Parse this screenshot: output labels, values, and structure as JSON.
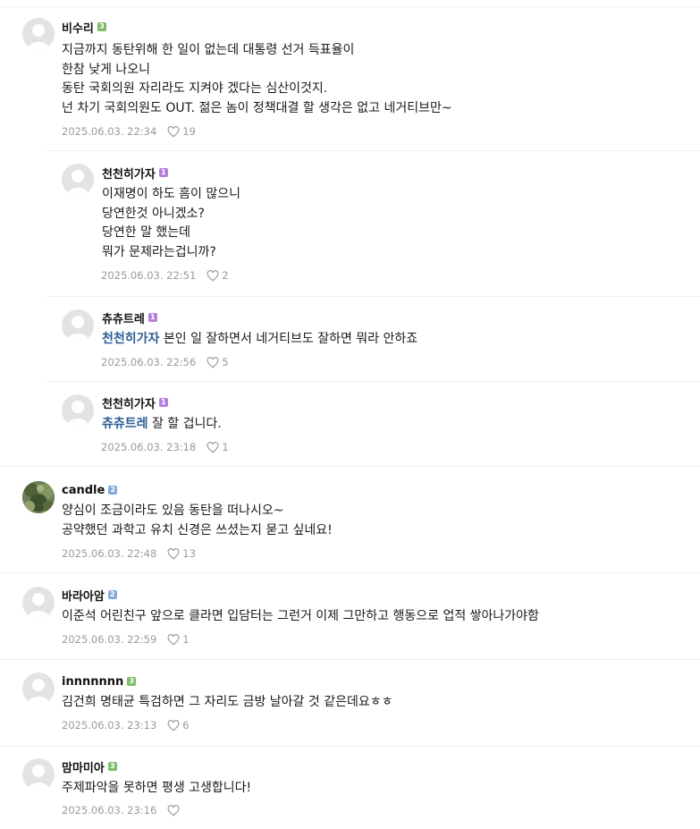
{
  "comments": [
    {
      "nick": "비수리",
      "level": "3",
      "lines": [
        "지금까지 동탄위해 한 일이 없는데 대통령 선거 득표율이",
        "한참 낮게 나오니",
        "동탄 국회의원 자리라도 지켜야 겠다는 심산이것지.",
        "넌 차기 국회의원도 OUT. 젊은 놈이 정책대결 할 생각은 없고 네거티브만~"
      ],
      "date": "2025.06.03. 22:34",
      "likes": "19"
    },
    {
      "nick": "천천히가자",
      "level": "1",
      "lines": [
        "이재명이 하도 흠이 많으니",
        "당연한것 아니겠소?",
        "당연한 말 했는데",
        "뭐가 문제라는겁니까?"
      ],
      "date": "2025.06.03. 22:51",
      "likes": "2"
    },
    {
      "nick": "츄츄트레",
      "level": "1",
      "mention": "천천히가자",
      "text": " 본인 일 잘하면서 네거티브도 잘하면 뭐라 안하죠",
      "date": "2025.06.03. 22:56",
      "likes": "5"
    },
    {
      "nick": "천천히가자",
      "level": "1",
      "mention": "츄츄트레",
      "text": " 잘 할 겁니다.",
      "date": "2025.06.03. 23:18",
      "likes": "1"
    },
    {
      "nick": "candle",
      "level": "2",
      "lines": [
        "양심이 조금이라도 있음 동탄을 떠나시오~",
        "공약했던 과학고 유치 신경은 쓰셨는지 묻고 싶네요!"
      ],
      "date": "2025.06.03. 22:48",
      "likes": "13"
    },
    {
      "nick": "바라아암",
      "level": "2",
      "lines": [
        "이준석 어린친구 앞으로 클라면 입담터는 그런거 이제 그만하고 행동으로 업적 쌓아나가야함"
      ],
      "date": "2025.06.03. 22:59",
      "likes": "1"
    },
    {
      "nick": "innnnnnn",
      "level": "3",
      "lines": [
        "김건희 명태균 특검하면 그 자리도 금방 날아갈 것 같은데요ㅎㅎ"
      ],
      "date": "2025.06.03. 23:13",
      "likes": "6"
    },
    {
      "nick": "맘마미아",
      "level": "3",
      "lines": [
        "주제파악을 못하면 평생 고생합니다!"
      ],
      "date": "2025.06.03. 23:16",
      "likes": ""
    }
  ]
}
